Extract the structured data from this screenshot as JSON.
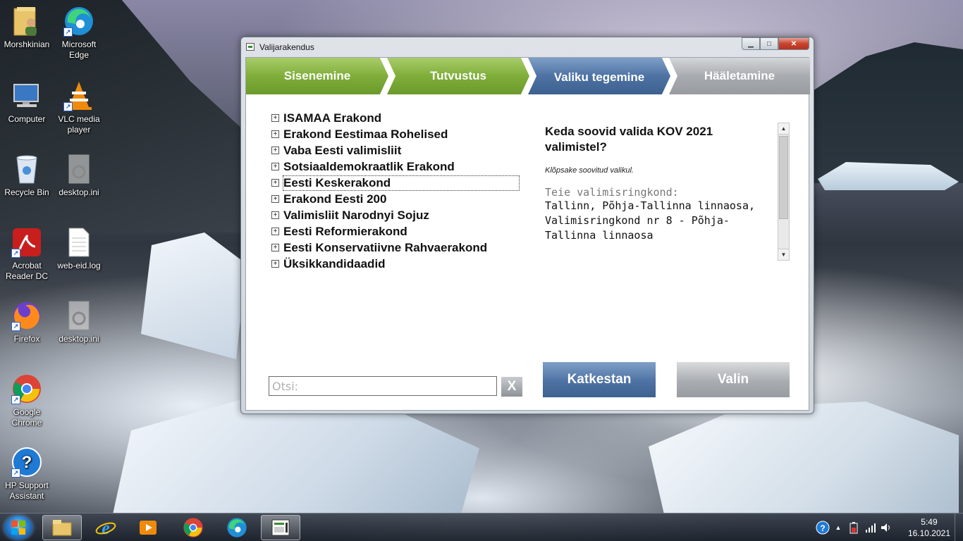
{
  "desktop": {
    "icons": [
      {
        "label": "Morshkinian"
      },
      {
        "label": "Microsoft Edge"
      },
      {
        "label": "Computer"
      },
      {
        "label": "VLC media player"
      },
      {
        "label": "Recycle Bin"
      },
      {
        "label": "desktop.ini"
      },
      {
        "label": "Acrobat Reader DC"
      },
      {
        "label": "web-eid.log"
      },
      {
        "label": "Firefox"
      },
      {
        "label": "desktop.ini"
      },
      {
        "label": "Google Chrome"
      },
      {
        "label": "HP Support Assistant"
      }
    ]
  },
  "window": {
    "title": "Valijarakendus",
    "steps": [
      {
        "label": "Sisenemine",
        "state": "done"
      },
      {
        "label": "Tutvustus",
        "state": "done"
      },
      {
        "label": "Valiku tegemine",
        "state": "active"
      },
      {
        "label": "Hääletamine",
        "state": "todo"
      }
    ],
    "parties": [
      {
        "label": "ISAMAA Erakond"
      },
      {
        "label": "Erakond Eestimaa Rohelised"
      },
      {
        "label": "Vaba Eesti valimisliit"
      },
      {
        "label": "Sotsiaaldemokraatlik Erakond"
      },
      {
        "label": "Eesti Keskerakond"
      },
      {
        "label": "Erakond Eesti 200"
      },
      {
        "label": "Valimisliit Narodnyi Sojuz"
      },
      {
        "label": "Eesti Reformierakond"
      },
      {
        "label": "Eesti Konservatiivne Rahvaerakond"
      },
      {
        "label": "Üksikkandidaadid"
      }
    ],
    "expander_symbol": "+",
    "info": {
      "title": "Keda soovid valida KOV 2021 valimistel?",
      "hint": "Klõpsake soovitud valikul.",
      "district_label": "Teie valimisringkond:",
      "district": "Tallinn, Põhja-Tallinna linnaosa, Valimisringkond nr 8 - Põhja-Tallinna linnaosa"
    },
    "search": {
      "placeholder": "Otsi:",
      "value": "",
      "clear_label": "X"
    },
    "cancel_label": "Katkestan",
    "choose_label": "Valin"
  },
  "taskbar": {
    "time": "5:49",
    "date": "16.10.2021"
  },
  "colors": {
    "step_done": "#7fae3a",
    "step_active": "#4d72a3",
    "step_todo": "#a8acb0"
  }
}
